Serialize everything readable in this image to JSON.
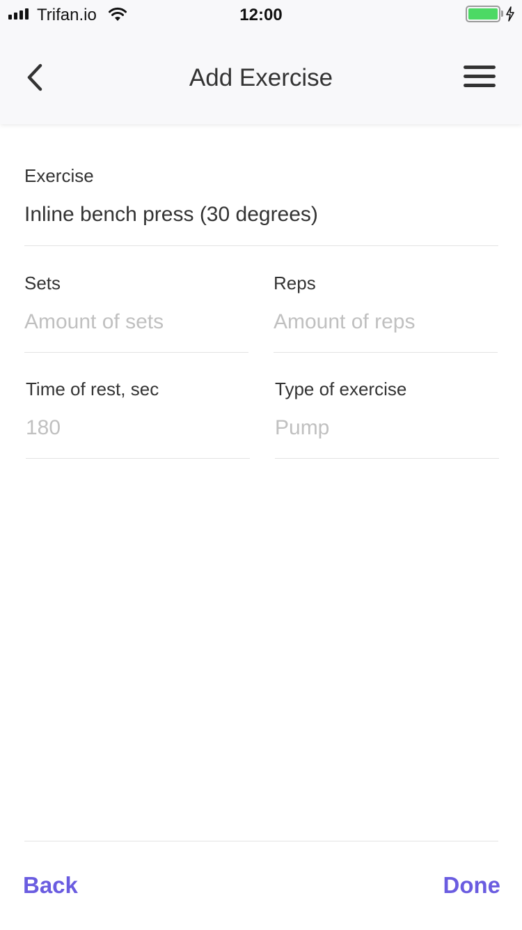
{
  "status_bar": {
    "carrier": "Trifan.io",
    "time": "12:00",
    "battery_level": 1.0
  },
  "header": {
    "title": "Add Exercise",
    "back_icon": "chevron-left-icon",
    "menu_icon": "hamburger-menu-icon"
  },
  "form": {
    "exercise": {
      "label": "Exercise",
      "value": "Inline bench press (30 degrees)"
    },
    "sets": {
      "label": "Sets",
      "placeholder": "Amount of sets"
    },
    "reps": {
      "label": "Reps",
      "placeholder": "Amount of reps"
    },
    "rest": {
      "label": "Time of rest, sec",
      "placeholder": "180"
    },
    "type": {
      "label": "Type of exercise",
      "placeholder": "Pump"
    }
  },
  "footer": {
    "back_label": "Back",
    "done_label": "Done"
  },
  "colors": {
    "accent": "#6a5ce0",
    "battery": "#4cd964",
    "header_bg": "#f8f8fa",
    "placeholder": "#c0c0c0"
  }
}
